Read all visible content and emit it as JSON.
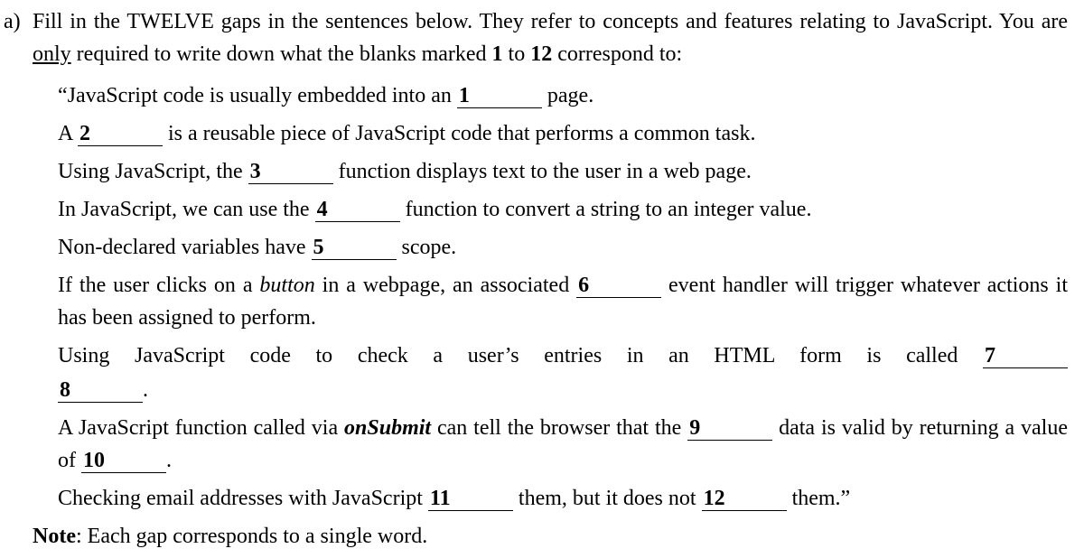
{
  "question_label": "a)",
  "intro_part1": "Fill in the TWELVE gaps in the sentences below. They refer to concepts and features relating to JavaScript. You are ",
  "intro_only": "only",
  "intro_part2": " required to write down what the blanks marked ",
  "intro_one": "1",
  "intro_to": " to ",
  "intro_twelve": "12",
  "intro_part3": " correspond to:",
  "s1a": "“JavaScript code is usually embedded into an ",
  "b1": "1",
  "s1b": " page.",
  "s2a": "A ",
  "b2": "2",
  "s2b": " is a reusable piece of JavaScript code that performs a common task.",
  "s3a": "Using JavaScript, the ",
  "b3": "3",
  "s3b": " function displays text to the user in a web page.",
  "s4a": "In JavaScript, we can use the ",
  "b4": "4",
  "s4b": " function to convert a string to an integer value.",
  "s5a": "Non-declared variables have ",
  "b5": "5",
  "s5b": " scope.",
  "s6a": "If the user clicks on a ",
  "s6button": "button",
  "s6b": " in a webpage, an associated ",
  "b6": "6",
  "s6c": " event handler will trigger whatever actions it has been assigned to perform.",
  "s7a": "Using JavaScript code to check a user’s entries in an HTML form is called ",
  "b7": "7",
  "s7mid": " ",
  "b8": "8",
  "s7b": ".",
  "s8a": "A JavaScript function called via ",
  "s8onsubmit": "onSubmit",
  "s8b": " can tell the browser that the ",
  "b9": "9",
  "s8c": " data is valid by returning a value of ",
  "b10": "10",
  "s8d": ".",
  "s9a": "Checking email addresses with JavaScript ",
  "b11": "11",
  "s9b": " them, but it does not ",
  "b12": "12",
  "s9c": " them.”",
  "note_label": "Note",
  "note_text": ": Each gap corresponds to a single word."
}
